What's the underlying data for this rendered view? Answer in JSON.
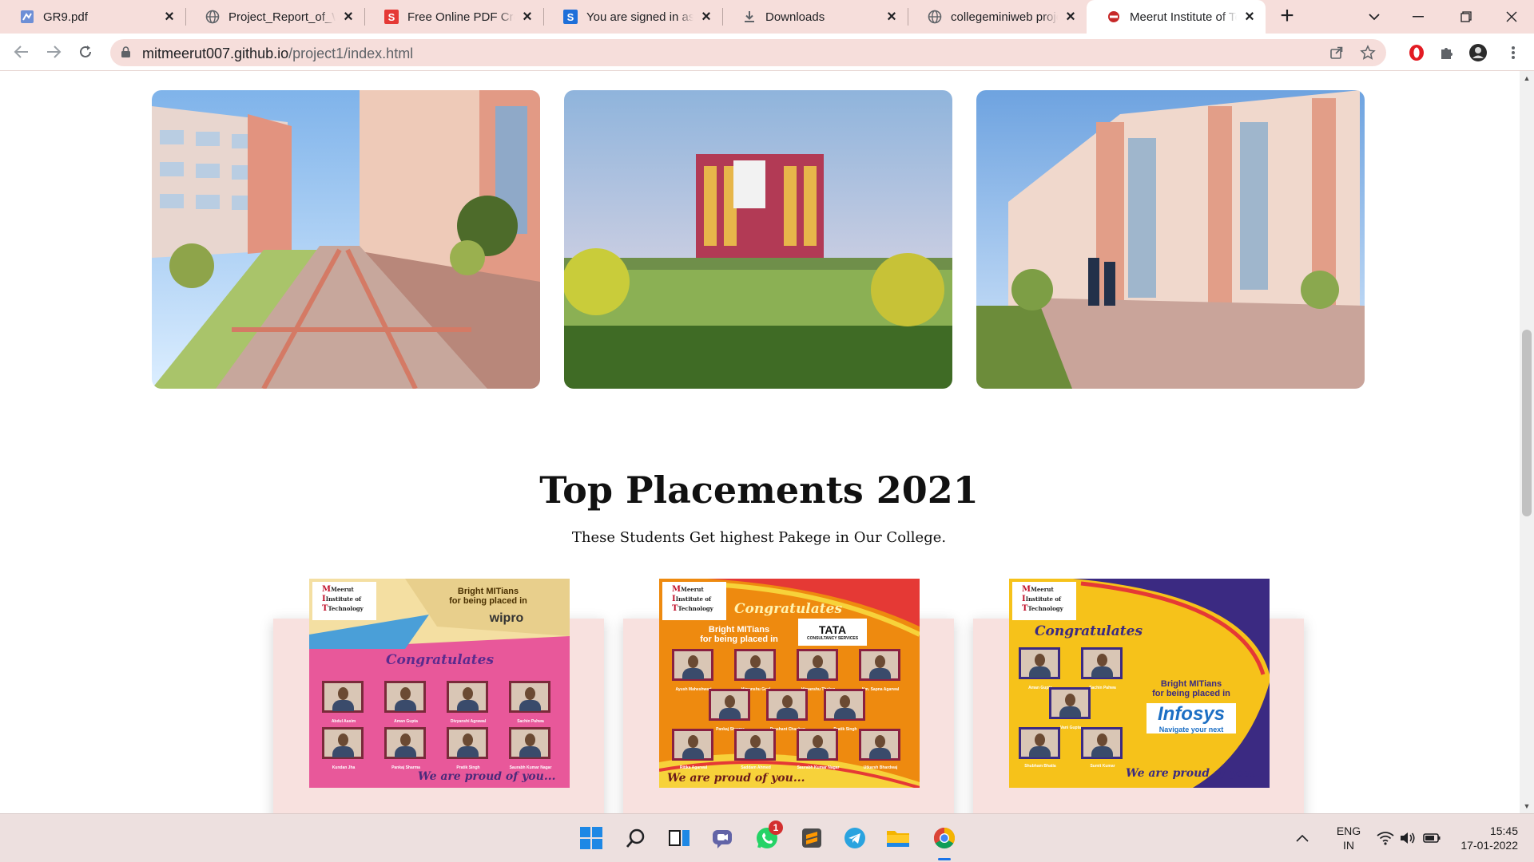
{
  "browser": {
    "tabs": [
      {
        "title": "GR9.pdf",
        "icon": "pdf-tab-icon"
      },
      {
        "title": "Project_Report_of_We",
        "icon": "globe-icon"
      },
      {
        "title": "Free Online PDF Creat",
        "icon": "s-red-icon"
      },
      {
        "title": "You are signed in as c",
        "icon": "s-blue-icon"
      },
      {
        "title": "Downloads",
        "icon": "download-icon"
      },
      {
        "title": "collegeminiweb proje",
        "icon": "globe-icon"
      },
      {
        "title": "Meerut Institute of Te",
        "icon": "mit-favicon-icon"
      }
    ],
    "url_host": "mitmeerut007.github.io",
    "url_path": "/project1/index.html"
  },
  "page": {
    "placements_title": "Top Placements 2021",
    "placements_subtitle": "These Students Get highest Pakege in Our College.",
    "posters": [
      {
        "company": "wipro",
        "bright": "Bright MITians\nfor being placed in",
        "congrats": "Congratulates",
        "proud": "We are proud of you...",
        "students": [
          "Abdul Aasim",
          "Aman Gupta",
          "Divyanshi Agrawal",
          "Sachin Pahwa",
          "Kundan Jha",
          "Pankaj Sharma",
          "Pratik Singh",
          "Saurabh Kumar Nagar"
        ]
      },
      {
        "company": "TATA",
        "company_sub": "CONSULTANCY SERVICES",
        "bright": "Bright MITians\nfor being placed in",
        "congrats": "Congratulates",
        "proud": "We are proud of you...",
        "students": [
          "Ayush Maheshwari",
          "Himanshu Goel",
          "Himanshu Thakur",
          "Km. Sapna Agarwal",
          "Pankaj Sharma",
          "Prashant Chauhan",
          "Pratik Singh",
          "Ritika Agarwal",
          "Saddam Ahmed",
          "Saurabh Kumar Nagar",
          "Utkarsh Bhardwaj"
        ]
      },
      {
        "company": "Infosys",
        "company_sub": "Navigate your next",
        "bright": "Bright MITians\nfor being placed in",
        "congrats": "Congratulates",
        "proud": "We are proud of you...",
        "students": [
          "Aman Gupta",
          "Sachin Pahwa",
          "Vani Gupta",
          "Shubham Bhatia",
          "Sumit Kumar"
        ]
      }
    ],
    "mit_logo": [
      "Meerut",
      "Institute of",
      "Technology"
    ]
  },
  "taskbar": {
    "whatsapp_badge": "1",
    "lang_top": "ENG",
    "lang_bottom": "IN",
    "time": "15:45",
    "date": "17-01-2022"
  },
  "colors": {
    "tabstrip": "#f6dedb",
    "omnibox": "#f6dedb",
    "taskbar": "#ede0df",
    "card_bg": "#f8e1df"
  }
}
